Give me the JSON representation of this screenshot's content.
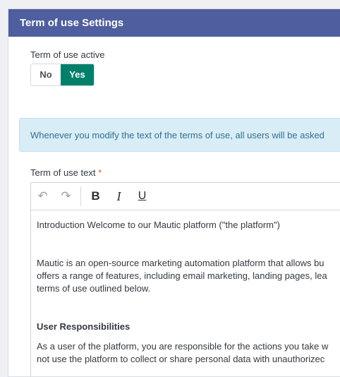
{
  "panel": {
    "title": "Term of use Settings"
  },
  "active_field": {
    "label": "Term of use active",
    "options": [
      "No",
      "Yes"
    ],
    "selected": "Yes"
  },
  "notice": {
    "text": "Whenever you modify the text of the terms of use, all users will be asked"
  },
  "text_field": {
    "label": "Term of use text",
    "required_mark": "*"
  },
  "toolbar": {
    "undo_glyph": "↶",
    "redo_glyph": "↷",
    "bold_glyph": "B",
    "italic_glyph": "I",
    "underline_glyph": "U"
  },
  "editor": {
    "intro": "Introduction Welcome to our Mautic platform (\"the platform\")",
    "body_lines": [
      "Mautic is an open-source marketing automation platform that allows bu",
      "offers a range of features, including email marketing, landing pages, lea",
      "terms of use outlined below."
    ],
    "heading": "User Responsibilities",
    "resp_lines": [
      "As a user of the platform, you are responsible for the actions you take w",
      "not use the platform to collect or share personal data with unauthorizec"
    ]
  },
  "colors": {
    "header_bg": "#4e5e9e",
    "toggle_active": "#00806a",
    "notice_bg": "#d9edf7",
    "required": "#e0632a"
  }
}
